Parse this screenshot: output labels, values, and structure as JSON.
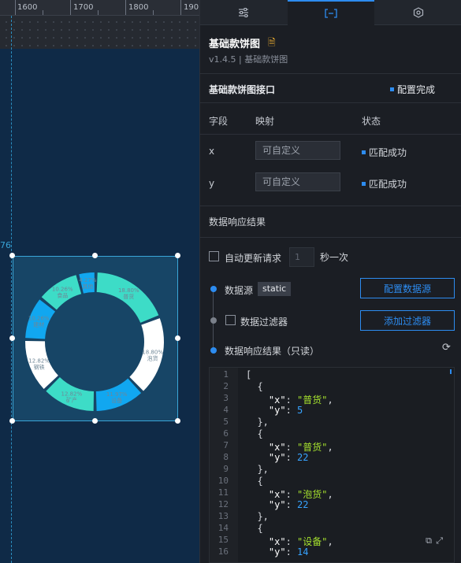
{
  "canvas": {
    "ruler_labels": [
      "1600",
      "1700",
      "1800",
      "190"
    ],
    "coord_label": "76",
    "chart_data": {
      "type": "pie",
      "categories": [
        "普货",
        "泡货",
        "设备",
        "矿产",
        "钢铁",
        "建材",
        "食品",
        "其他"
      ],
      "values": [
        18.8,
        18.8,
        11.97,
        12.82,
        12.82,
        10.26,
        10.26,
        4.27
      ],
      "labels": [
        "18.80%",
        "18.80%",
        "11.97%",
        "12.82%",
        "12.82%",
        "10.26%",
        "10.26%",
        "4.27%"
      ],
      "colors": [
        "#3ddcc7",
        "#ffffff",
        "#11a7f0",
        "#3ddcc7",
        "#ffffff",
        "#11a7f0",
        "#3ddcc7",
        "#11a7f0"
      ],
      "donut": true
    }
  },
  "panel": {
    "tabs": [
      {
        "name": "sliders-icon"
      },
      {
        "name": "bracket-icon"
      },
      {
        "name": "hexagon-icon"
      }
    ],
    "title": "基础款饼图",
    "subtitle": "v1.4.5 | 基础款饼图",
    "section_title": "基础款饼图接口",
    "config_done": "配置完成",
    "columns": [
      "字段",
      "映射",
      "状态"
    ],
    "fields": [
      {
        "name": "x",
        "placeholder": "可自定义",
        "status": "匹配成功"
      },
      {
        "name": "y",
        "placeholder": "可自定义",
        "status": "匹配成功"
      }
    ],
    "response_section": "数据响应结果",
    "auto_update_label": "自动更新请求",
    "interval_value": "1",
    "interval_unit": "秒一次",
    "datasource_label": "数据源",
    "datasource_type": "static",
    "config_datasource_btn": "配置数据源",
    "filter_label": "数据过滤器",
    "add_filter_btn": "添加过滤器",
    "response_label": "数据响应结果（只读）",
    "code_lines": [
      "[",
      "  {",
      "    \"x\": \"普货\",",
      "    \"y\": 5",
      "  },",
      "  {",
      "    \"x\": \"普货\",",
      "    \"y\": 22",
      "  },",
      "  {",
      "    \"x\": \"泡货\",",
      "    \"y\": 22",
      "  },",
      "  {",
      "    \"x\": \"设备\",",
      "    \"y\": 14"
    ]
  }
}
